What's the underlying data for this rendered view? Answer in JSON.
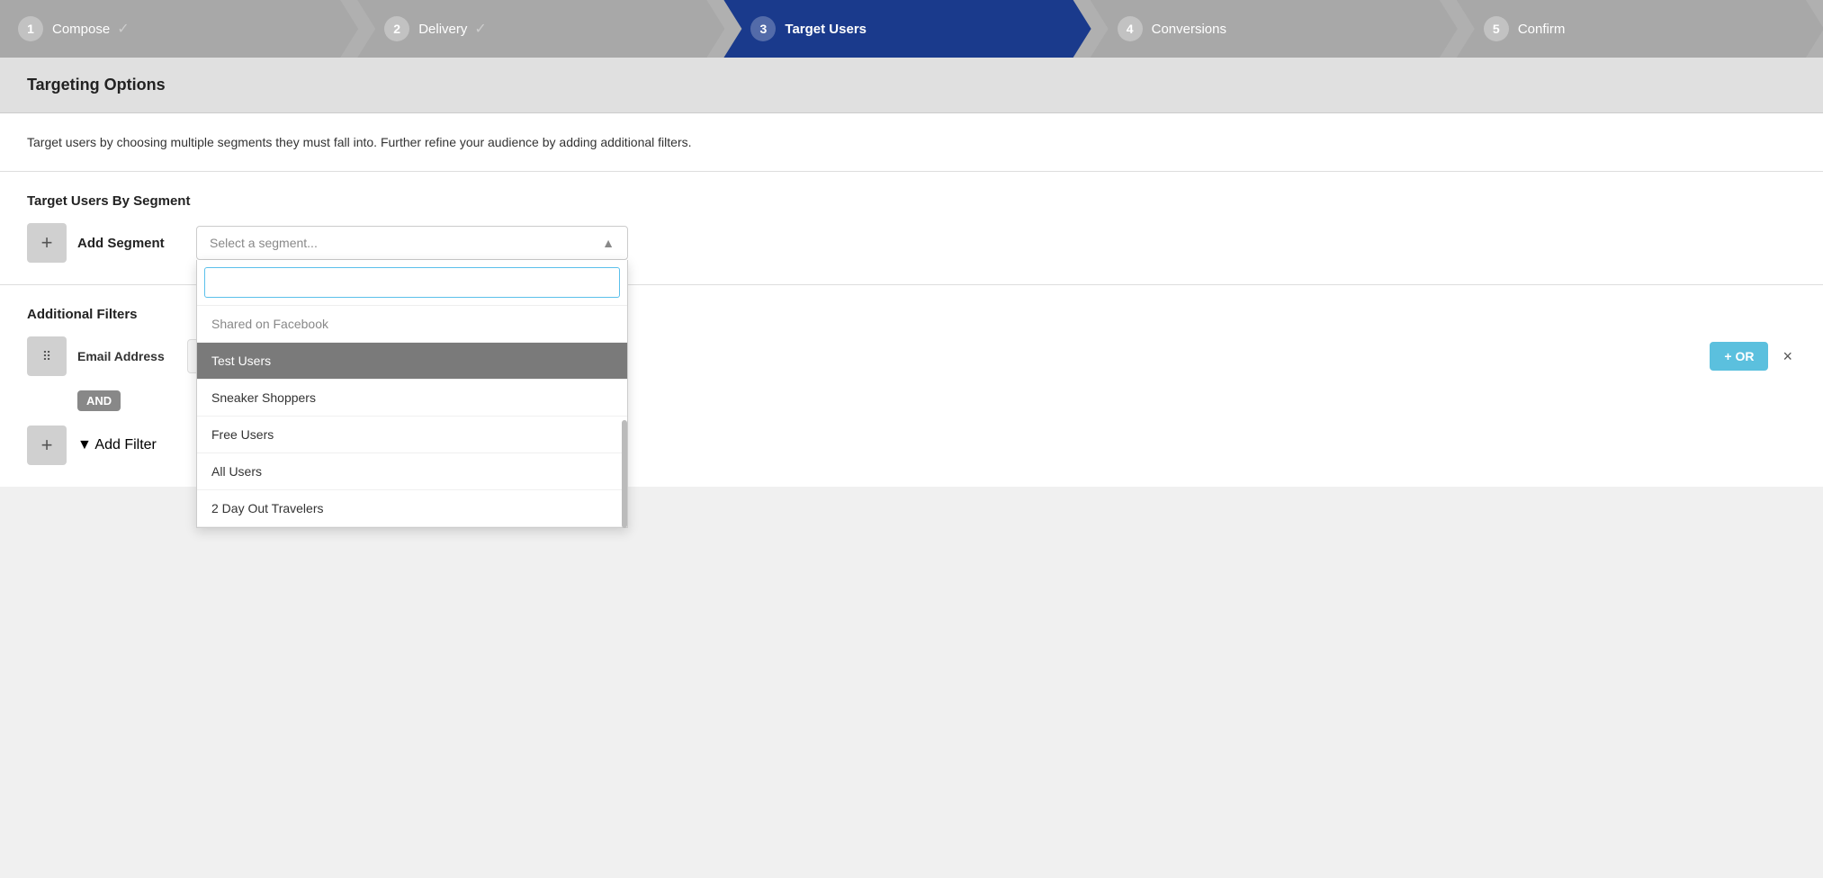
{
  "wizard": {
    "steps": [
      {
        "id": "compose",
        "num": "1",
        "label": "Compose",
        "state": "done",
        "check": "✓"
      },
      {
        "id": "delivery",
        "num": "2",
        "label": "Delivery",
        "state": "done",
        "check": "✓"
      },
      {
        "id": "target-users",
        "num": "3",
        "label": "Target Users",
        "state": "active"
      },
      {
        "id": "conversions",
        "num": "4",
        "label": "Conversions",
        "state": "inactive"
      },
      {
        "id": "confirm",
        "num": "5",
        "label": "Confirm",
        "state": "inactive"
      }
    ]
  },
  "page": {
    "section_title": "Targeting Options",
    "description": "Target users by choosing multiple segments they must fall into. Further refine your audience by adding additional filters.",
    "segment_section_title": "Target Users By Segment",
    "add_segment_label": "Add Segment",
    "segment_placeholder": "Select a segment...",
    "dropdown_items": [
      {
        "id": "shared-fb",
        "label": "Shared on Facebook",
        "state": "faded"
      },
      {
        "id": "test-users",
        "label": "Test Users",
        "state": "selected"
      },
      {
        "id": "sneaker-shoppers",
        "label": "Sneaker Shoppers",
        "state": "normal"
      },
      {
        "id": "free-users",
        "label": "Free Users",
        "state": "normal"
      },
      {
        "id": "all-users",
        "label": "All Users",
        "state": "normal"
      },
      {
        "id": "2day-travelers",
        "label": "2 Day Out Travelers",
        "state": "normal"
      }
    ],
    "filters_section_title": "Additional Filters",
    "filter": {
      "label": "Email Address",
      "or_label": "+ OR",
      "remove_label": "×"
    },
    "and_badge": "AND",
    "add_filter_label": "▼ Add Filter",
    "plus_icon": "+",
    "chevron_up": "▲"
  }
}
